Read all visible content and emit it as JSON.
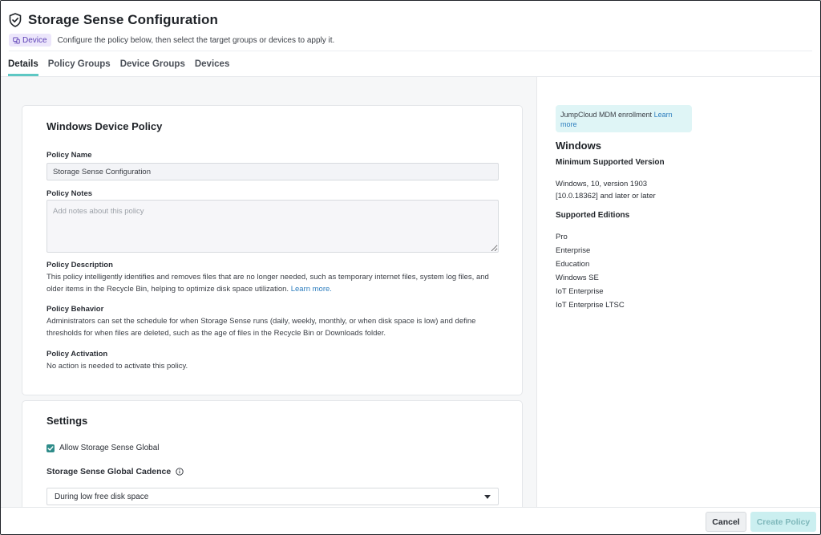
{
  "header": {
    "title": "Storage Sense Configuration",
    "badge": "Device",
    "subtitle": "Configure the policy below, then select the target groups or devices to apply it."
  },
  "tabs": [
    {
      "label": "Details",
      "active": true
    },
    {
      "label": "Policy Groups",
      "active": false
    },
    {
      "label": "Device Groups",
      "active": false
    },
    {
      "label": "Devices",
      "active": false
    }
  ],
  "policy_card": {
    "title": "Windows Device Policy",
    "name_label": "Policy Name",
    "name_value": "Storage Sense Configuration",
    "notes_label": "Policy Notes",
    "notes_placeholder": "Add notes about this policy",
    "description_label": "Policy Description",
    "description_text": "This policy intelligently identifies and removes files that are no longer needed, such as temporary internet files, system log files, and older items in the Recycle Bin, helping to optimize disk space utilization.",
    "description_link": "Learn more.",
    "behavior_label": "Policy Behavior",
    "behavior_text": "Administrators can set the schedule for when Storage Sense runs (daily, weekly, monthly, or when disk space is low) and define thresholds for when files are deleted, such as the age of files in the Recycle Bin or Downloads folder.",
    "activation_label": "Policy Activation",
    "activation_text": "No action is needed to activate this policy."
  },
  "settings_card": {
    "title": "Settings",
    "checkbox_label": "Allow Storage Sense Global",
    "checkbox_checked": true,
    "cadence_label": "Storage Sense Global Cadence",
    "cadence_value": "During low free disk space"
  },
  "side": {
    "notice_text": "JumpCloud MDM enrollment",
    "notice_link": "Learn more",
    "os_title": "Windows",
    "min_version_label": "Minimum Supported Version",
    "min_version_text": "Windows, 10, version 1903 [10.0.18362] and later or later",
    "editions_label": "Supported Editions",
    "editions": [
      "Pro",
      "Enterprise",
      "Education",
      "Windows SE",
      "IoT Enterprise",
      "IoT Enterprise LTSC"
    ]
  },
  "footer": {
    "cancel_label": "Cancel",
    "create_label": "Create Policy"
  },
  "colors": {
    "accent": "#5ec8c4",
    "checkbox": "#2f8c8a",
    "link": "#2f7fbf",
    "badge_bg": "#ece6fb",
    "badge_text": "#5b3fb5"
  }
}
